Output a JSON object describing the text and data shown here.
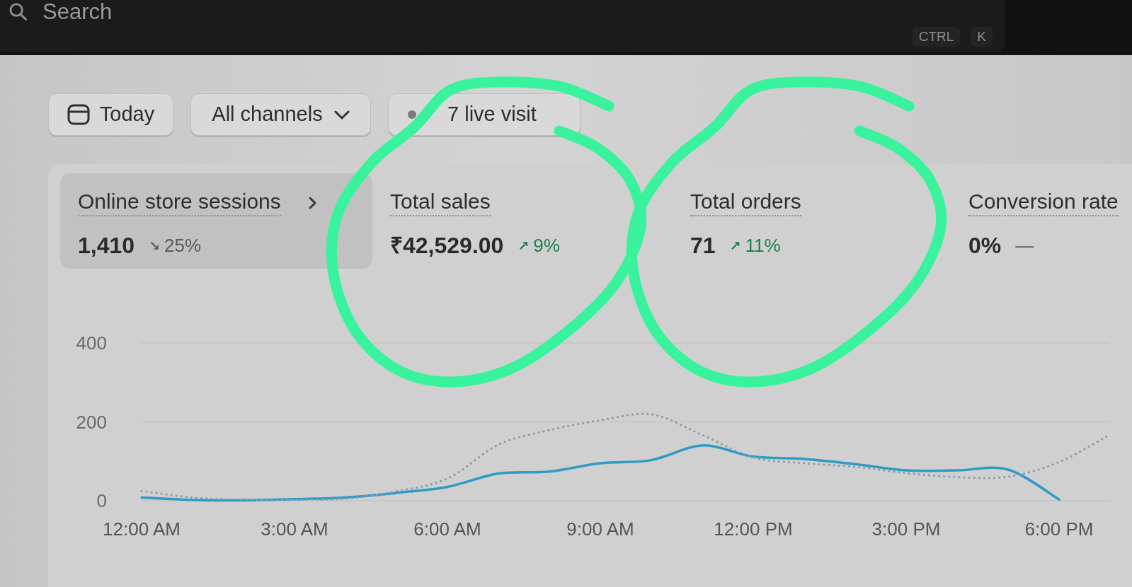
{
  "top_bar": {
    "search": {
      "placeholder": "Search"
    },
    "shortcut": [
      "CTRL",
      "K"
    ]
  },
  "filters": [
    {
      "kind": "date",
      "label": "Today"
    },
    {
      "kind": "dropdown",
      "label": "All channels"
    },
    {
      "kind": "live",
      "label": "7 live visit"
    }
  ],
  "metrics": [
    {
      "label": "Online store sessions",
      "value": "1,410",
      "change": {
        "arrow": "↘",
        "text": "25%",
        "positive": false
      },
      "selected": true,
      "chevron": true,
      "circled": false
    },
    {
      "label": "Total sales",
      "value": "₹42,529.00",
      "change": {
        "arrow": "↗",
        "text": "9%",
        "positive": true
      },
      "selected": false,
      "chevron": false,
      "circled": true
    },
    {
      "label": "Total orders",
      "value": "71",
      "change": {
        "arrow": "↗",
        "text": "11%",
        "positive": true
      },
      "selected": false,
      "chevron": false,
      "circled": true
    },
    {
      "label": "Conversion rate",
      "value": "0%",
      "change": {
        "text": "—",
        "positive": false
      },
      "selected": false,
      "chevron": false,
      "circled": false
    }
  ],
  "chart": {
    "chart_data": {
      "type": "line",
      "x": [
        0,
        1,
        2,
        3,
        4,
        5,
        6,
        7,
        8,
        9,
        10,
        11,
        12,
        13,
        14,
        15,
        16,
        17,
        18,
        19
      ],
      "xlim": [
        0,
        19
      ],
      "ylim": [
        0,
        400
      ],
      "xticks": [
        {
          "value": 0,
          "label": "12:00 AM"
        },
        {
          "value": 3,
          "label": "3:00 AM"
        },
        {
          "value": 6,
          "label": "6:00 AM"
        },
        {
          "value": 9,
          "label": "9:00 AM"
        },
        {
          "value": 12,
          "label": "12:00 PM"
        },
        {
          "value": 15,
          "label": "3:00 PM"
        },
        {
          "value": 18,
          "label": "6:00 PM"
        }
      ],
      "yticks": [
        0,
        200,
        400
      ],
      "series": [
        {
          "color": "#2e9ac6",
          "line_style": "solid",
          "values": [
            8,
            2,
            1,
            4,
            8,
            20,
            35,
            69,
            74,
            95,
            103,
            140,
            112,
            106,
            93,
            77,
            77,
            79,
            3,
            null
          ]
        },
        {
          "color": "#86a0ab",
          "line_style": "dotted",
          "values": [
            25,
            8,
            3,
            3,
            5,
            24,
            56,
            142,
            179,
            204,
            219,
            167,
            110,
            95,
            86,
            70,
            60,
            61,
            98,
            168
          ]
        }
      ]
    }
  }
}
